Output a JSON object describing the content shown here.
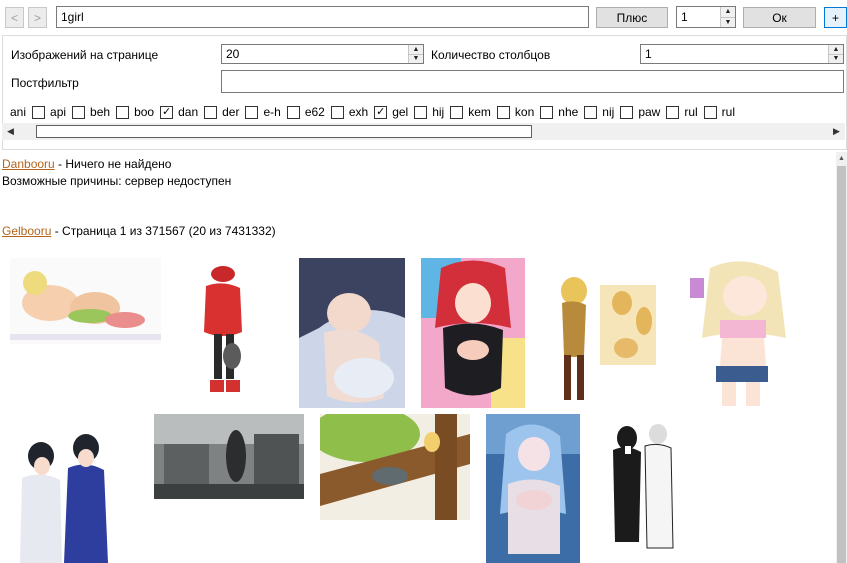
{
  "toolbar": {
    "back_label": "<",
    "forward_label": ">",
    "query_value": "1girl",
    "plus_label": "Плюс",
    "count_value": "1",
    "ok_label": "Ок",
    "add_label": "+"
  },
  "settings": {
    "per_page_label": "Изображений на странице",
    "per_page_value": "20",
    "columns_label": "Количество столбцов",
    "columns_value": "1",
    "postfilter_label": "Постфильтр",
    "postfilter_value": ""
  },
  "sources": [
    {
      "label": "ani",
      "checked": false
    },
    {
      "label": "api",
      "checked": false
    },
    {
      "label": "beh",
      "checked": false
    },
    {
      "label": "boo",
      "checked": false
    },
    {
      "label": "dan",
      "checked": true
    },
    {
      "label": "der",
      "checked": false
    },
    {
      "label": "e-h",
      "checked": false
    },
    {
      "label": "e62",
      "checked": false
    },
    {
      "label": "exh",
      "checked": false
    },
    {
      "label": "gel",
      "checked": true
    },
    {
      "label": "hij",
      "checked": false
    },
    {
      "label": "kem",
      "checked": false
    },
    {
      "label": "kon",
      "checked": false
    },
    {
      "label": "nhe",
      "checked": false
    },
    {
      "label": "nij",
      "checked": false
    },
    {
      "label": "paw",
      "checked": false
    },
    {
      "label": "rul",
      "checked": false
    },
    {
      "label": "rul",
      "checked": false
    }
  ],
  "results": {
    "danbooru": {
      "site": "Danbooru",
      "status": " - Ничего не найдено",
      "reason": "Возможные причины: сервер недоступен"
    },
    "gelbooru": {
      "site": "Gelbooru",
      "status": " - Страница 1 из 371567 (20 из 7431332)"
    }
  },
  "colors": {
    "link": "#b5651d",
    "accent_border": "#0078d7",
    "panel_border": "#dcdcdc"
  }
}
